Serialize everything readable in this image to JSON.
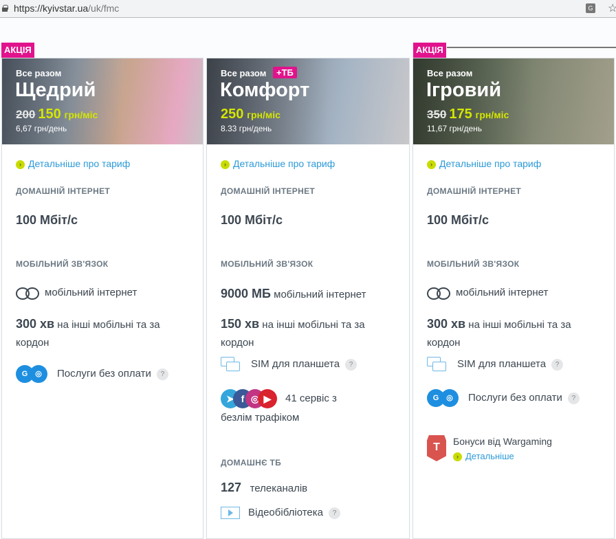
{
  "browser": {
    "url_host": "https://kyivstar.ua",
    "url_path": "/uk/fmc"
  },
  "promo_badge": "АКЦІЯ",
  "common": {
    "all_together": "Все разом",
    "details_link": "Детальніше про тариф",
    "home_internet": "ДОМАШНІЙ ІНТЕРНЕТ",
    "speed": "100 Мбіт/с",
    "mobile": "МОБІЛЬНИЙ ЗВ'ЯЗОК",
    "mobile_internet": "мобільний інтернет",
    "minutes_text": "на інші мобільні та за",
    "minutes_text2": "кордон",
    "sim_tablet": "SIM для планшета",
    "free_services": "Послуги без оплати",
    "question": "?",
    "unit": "грн/міс"
  },
  "cards": [
    {
      "name": "Щедрий",
      "old_price": "200",
      "price": "150",
      "per_day": "6,67 грн/день",
      "minutes": "300 хв"
    },
    {
      "name": "Комфорт",
      "tag": "+ТБ",
      "price": "250",
      "per_day": "8.33 грн/день",
      "data": "9000 МБ",
      "minutes": "150 хв",
      "services_1": "41 сервіс з",
      "services_2": "безлім трафіком",
      "home_tv": "ДОМАШНЄ ТБ",
      "channels": "127",
      "channels_label": "телеканалів",
      "video_library": "Відеобібліотека"
    },
    {
      "name": "Ігровий",
      "old_price": "350",
      "price": "175",
      "per_day": "11,67 грн/день",
      "minutes": "300 хв",
      "wargaming": "Бонуси від Wargaming",
      "more": "Детальніше"
    }
  ]
}
